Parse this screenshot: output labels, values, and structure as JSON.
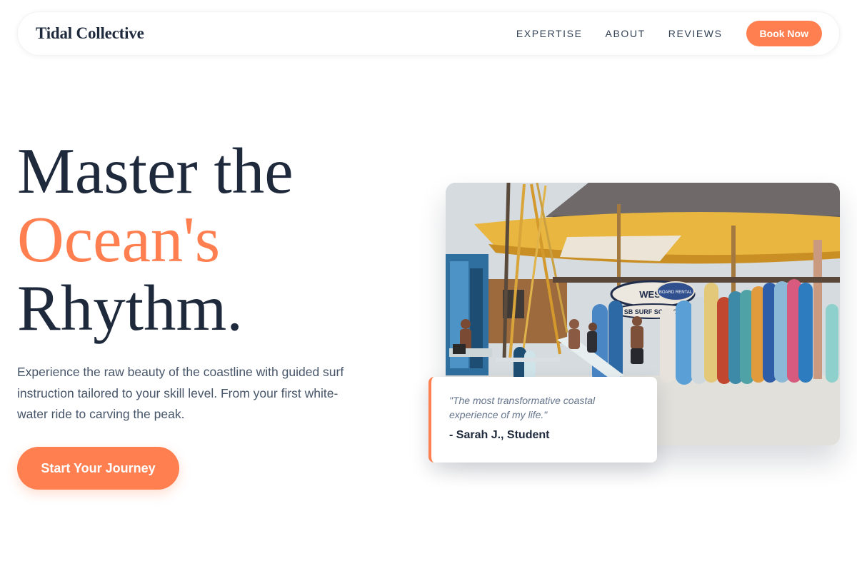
{
  "header": {
    "brand": "Tidal Collective",
    "nav": [
      "EXPERTISE",
      "ABOUT",
      "REVIEWS"
    ],
    "cta_label": "Book Now"
  },
  "hero": {
    "title_lines": [
      "Master the",
      "Ocean's",
      "Rhythm."
    ],
    "description": "Experience the raw beauty of the coastline with guided surf instruction tailored to your skill level. From your first white-water ride to carving the peak.",
    "cta_label": "Start Your Journey"
  },
  "photo": {
    "signs": [
      "WEST",
      "SB SURF SCHOOL",
      "BOARD RENTAL"
    ]
  },
  "testimonial": {
    "quote": "\"The most transformative coastal experience of my life.\"",
    "author": "- Sarah J., Student"
  },
  "colors": {
    "accent": "#ff7f50",
    "heading": "#1e293b",
    "body": "#475569"
  }
}
